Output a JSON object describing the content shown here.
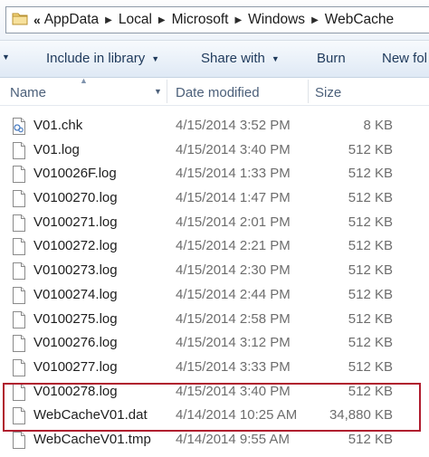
{
  "address": {
    "overflow": "«",
    "crumbs": [
      "AppData",
      "Local",
      "Microsoft",
      "Windows",
      "WebCache"
    ]
  },
  "toolbar": {
    "include_label": "Include in library",
    "share_label": "Share with",
    "burn_label": "Burn",
    "newfolder_label": "New fol"
  },
  "columns": {
    "name": "Name",
    "date": "Date modified",
    "size": "Size"
  },
  "files": [
    {
      "name": "V01.chk",
      "date": "4/15/2014 3:52 PM",
      "size": "8 KB",
      "icon": "chk-file-icon"
    },
    {
      "name": "V01.log",
      "date": "4/15/2014 3:40 PM",
      "size": "512 KB",
      "icon": "document-icon"
    },
    {
      "name": "V010026F.log",
      "date": "4/15/2014 1:33 PM",
      "size": "512 KB",
      "icon": "document-icon"
    },
    {
      "name": "V0100270.log",
      "date": "4/15/2014 1:47 PM",
      "size": "512 KB",
      "icon": "document-icon"
    },
    {
      "name": "V0100271.log",
      "date": "4/15/2014 2:01 PM",
      "size": "512 KB",
      "icon": "document-icon"
    },
    {
      "name": "V0100272.log",
      "date": "4/15/2014 2:21 PM",
      "size": "512 KB",
      "icon": "document-icon"
    },
    {
      "name": "V0100273.log",
      "date": "4/15/2014 2:30 PM",
      "size": "512 KB",
      "icon": "document-icon"
    },
    {
      "name": "V0100274.log",
      "date": "4/15/2014 2:44 PM",
      "size": "512 KB",
      "icon": "document-icon"
    },
    {
      "name": "V0100275.log",
      "date": "4/15/2014 2:58 PM",
      "size": "512 KB",
      "icon": "document-icon"
    },
    {
      "name": "V0100276.log",
      "date": "4/15/2014 3:12 PM",
      "size": "512 KB",
      "icon": "document-icon"
    },
    {
      "name": "V0100277.log",
      "date": "4/15/2014 3:33 PM",
      "size": "512 KB",
      "icon": "document-icon"
    },
    {
      "name": "V0100278.log",
      "date": "4/15/2014 3:40 PM",
      "size": "512 KB",
      "icon": "document-icon"
    },
    {
      "name": "WebCacheV01.dat",
      "date": "4/14/2014 10:25 AM",
      "size": "34,880 KB",
      "icon": "document-icon"
    },
    {
      "name": "WebCacheV01.tmp",
      "date": "4/14/2014 9:55 AM",
      "size": "512 KB",
      "icon": "document-icon"
    }
  ],
  "colors": {
    "highlight": "#b01c2e",
    "toolbar_text": "#1e395b",
    "header_text": "#4c607a"
  }
}
